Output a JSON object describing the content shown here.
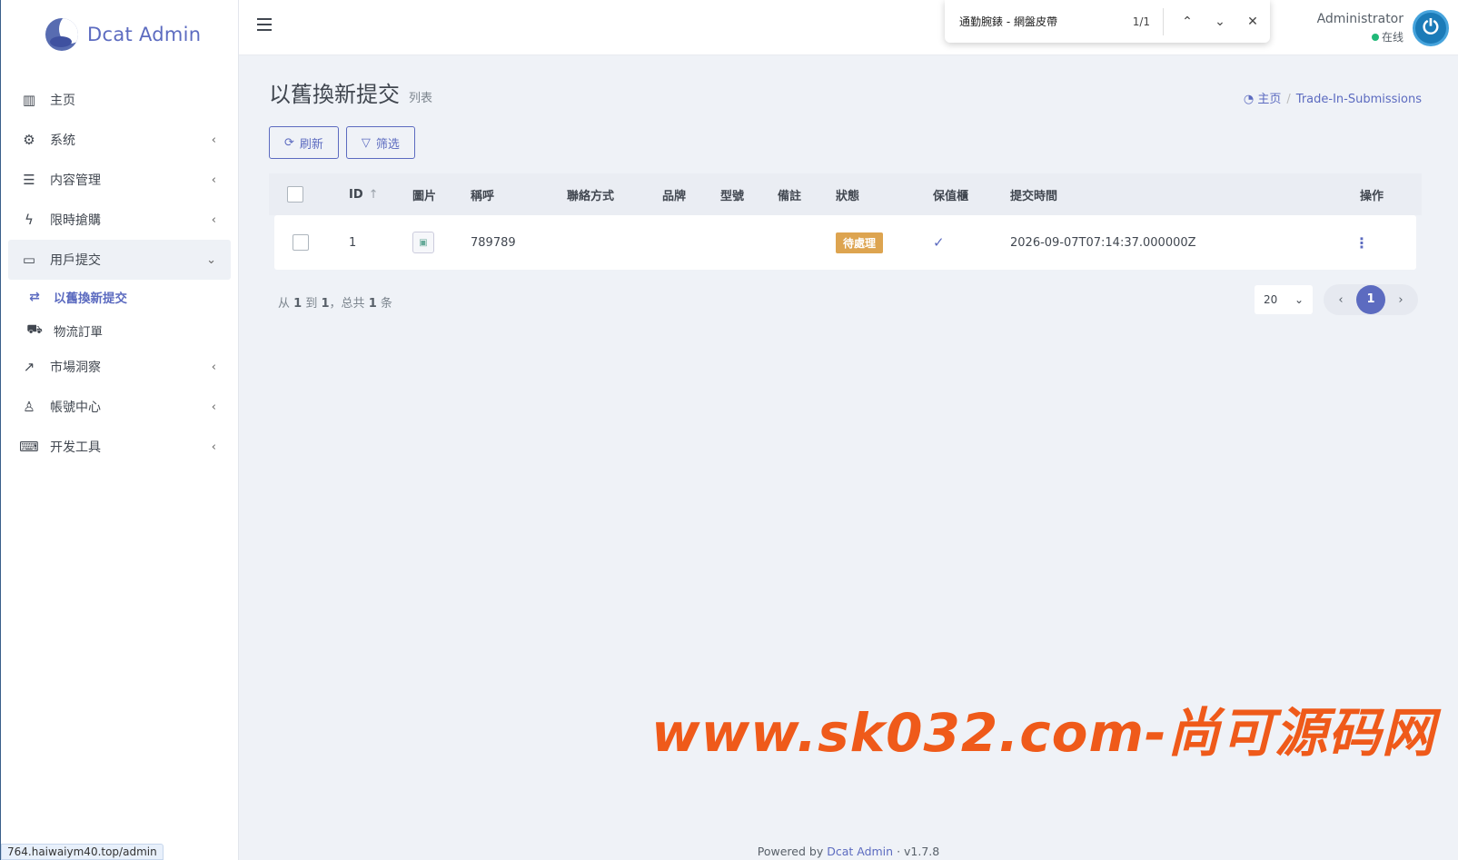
{
  "brand": {
    "name": "Dcat Admin"
  },
  "sidebar": {
    "items": [
      {
        "label": "主页",
        "icon": "bar-chart-icon",
        "glyph": "▥",
        "arrow": ""
      },
      {
        "label": "系统",
        "icon": "gear-icon",
        "glyph": "⚙",
        "arrow": "‹"
      },
      {
        "label": "内容管理",
        "icon": "database-icon",
        "glyph": "☰",
        "arrow": "‹"
      },
      {
        "label": "限時搶購",
        "icon": "lightning-icon",
        "glyph": "ϟ",
        "arrow": "‹"
      },
      {
        "label": "用戶提交",
        "icon": "inbox-icon",
        "glyph": "▭",
        "arrow": "⌄"
      },
      {
        "label": "以舊換新提交",
        "icon": "exchange-icon",
        "glyph": "⇄"
      },
      {
        "label": "物流訂單",
        "icon": "truck-icon",
        "glyph": "⛟"
      },
      {
        "label": "市場洞察",
        "icon": "trending-up-icon",
        "glyph": "↗",
        "arrow": "‹"
      },
      {
        "label": "帳號中心",
        "icon": "user-icon",
        "glyph": "♙",
        "arrow": "‹"
      },
      {
        "label": "开发工具",
        "icon": "keyboard-icon",
        "glyph": "⌨",
        "arrow": "‹"
      }
    ]
  },
  "findbar": {
    "query": "通勤腕錶 - 網盤皮帶",
    "count": "1/1"
  },
  "user": {
    "name": "Administrator",
    "status": "在线"
  },
  "page": {
    "title": "以舊換新提交",
    "subtitle": "列表"
  },
  "breadcrumb": {
    "home": "主页",
    "current": "Trade-In-Submissions"
  },
  "toolbar": {
    "refresh": "刷新",
    "filter": "筛选"
  },
  "table": {
    "headers": {
      "id": "ID",
      "image": "圖片",
      "name": "稱呼",
      "contact": "聯絡方式",
      "brand": "品牌",
      "model": "型號",
      "note": "備註",
      "status": "狀態",
      "warranty": "保值櫃",
      "time": "提交時間",
      "action": "操作"
    },
    "rows": [
      {
        "id": "1",
        "name": "789789",
        "contact": "",
        "brand": "",
        "model": "",
        "note": "",
        "status": "待處理",
        "warranty": "✓",
        "time": "2026-09-07T07:14:37.000000Z"
      }
    ]
  },
  "summary": {
    "from_label": "从",
    "from": "1",
    "to_label": "到",
    "to": "1",
    "total_label": "，总共",
    "total": "1",
    "unit": "条"
  },
  "pager": {
    "per_page": "20",
    "current": "1"
  },
  "watermark": "www.sk032.com-尚可源码网",
  "footer": {
    "powered": "Powered by",
    "link": "Dcat Admin",
    "dot": "·",
    "version": "v1.7.8"
  },
  "statusbar": {
    "url": "764.haiwaiym40.top/admin"
  },
  "colors": {
    "accent": "#5c6bc0",
    "badge": "#dda450",
    "online": "#21b978",
    "watermark": "#ef5a1a"
  }
}
